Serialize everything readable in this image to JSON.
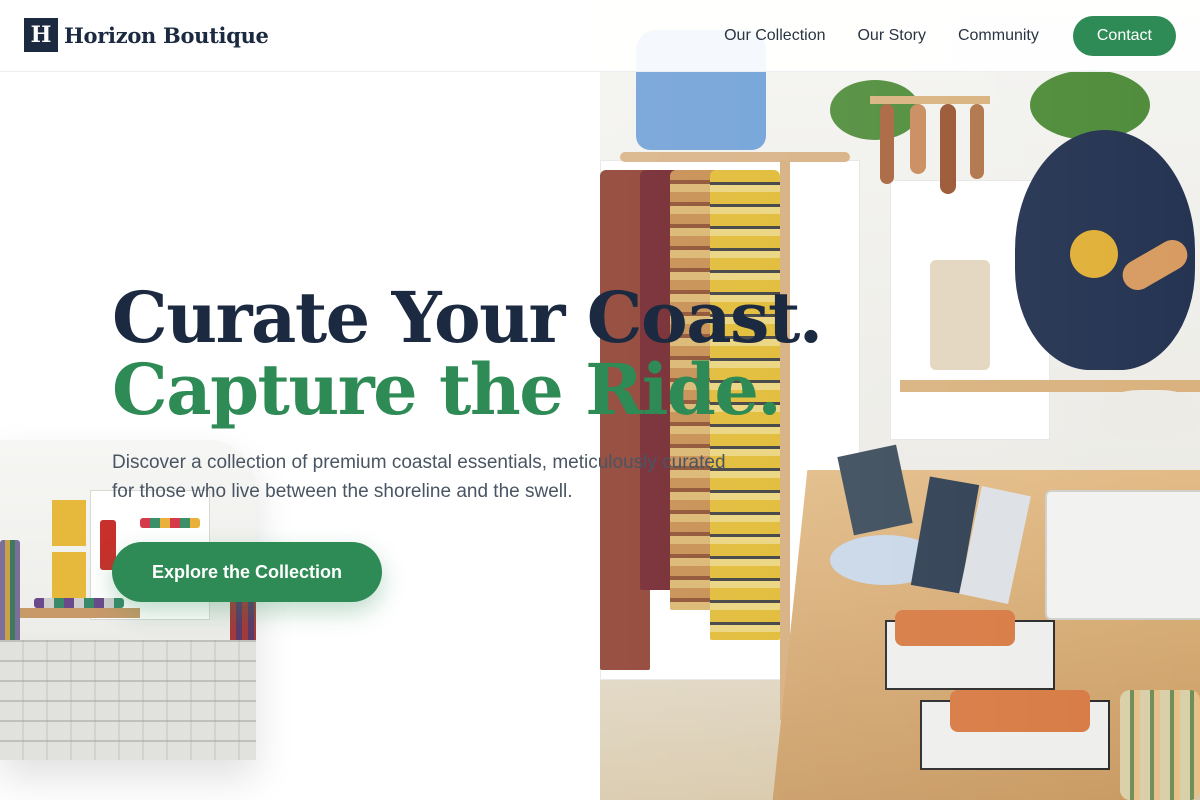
{
  "brand": {
    "logo_letter": "H",
    "name": "Horizon Boutique"
  },
  "nav": {
    "items": [
      {
        "label": "Our Collection"
      },
      {
        "label": "Our Story"
      },
      {
        "label": "Community"
      }
    ],
    "cta_label": "Contact"
  },
  "hero": {
    "title_line1": "Curate Your Coast.",
    "title_line2": "Capture the Ride.",
    "subtitle": "Discover a collection of premium coastal essentials, meticulously curated for those who live between the shoreline and the swell.",
    "cta_label": "Explore the Collection"
  },
  "colors": {
    "brand_navy": "#1b2a40",
    "accent_green": "#2e8b55"
  }
}
